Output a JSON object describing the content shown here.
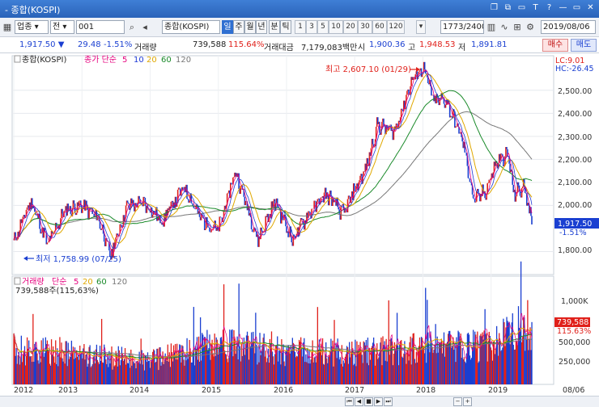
{
  "window": {
    "title": "종합(KOSPI)"
  },
  "window_controls": [
    "❐",
    "⧉",
    "▭",
    "T",
    "?",
    "—",
    "▭",
    "✕"
  ],
  "toolbar": {
    "market": "업종",
    "prefix": "전",
    "code": "001",
    "name": "종합(KOSPI)",
    "periods": [
      "일",
      "주",
      "월",
      "년",
      "분",
      "틱"
    ],
    "active_period": "일",
    "intervals": [
      "1",
      "3",
      "5",
      "10",
      "20",
      "30",
      "60",
      "120"
    ],
    "count": "1773/2400",
    "date": "2019/08/06"
  },
  "quote": {
    "price": "1,917.50",
    "arrow": "▼",
    "change": "29.48",
    "change_pct": "-1.51%",
    "volume_label": "거래량",
    "volume": "739,588",
    "volume_pct": "115.64%",
    "amount_label": "거래대금",
    "amount": "7,179,083백만",
    "open_label": "시",
    "open": "1,900.36",
    "high_label": "고",
    "high": "1,948.53",
    "low_label": "저",
    "low": "1,891.81",
    "buy": "매수",
    "sell": "매도"
  },
  "colors": {
    "up": "#e0201a",
    "down": "#1a3fd1",
    "ma5": "#e6007e",
    "ma10": "#1f3bd6",
    "ma20": "#e0a800",
    "ma60": "#1a8a2a",
    "ma120": "#777777"
  },
  "price_legend": {
    "name": "종합(KOSPI)",
    "type": "종가 단순",
    "periods": [
      "5",
      "10",
      "20",
      "60",
      "120"
    ]
  },
  "volume_legend": {
    "name": "거래량",
    "type": "단순",
    "periods": [
      "5",
      "20",
      "60",
      "120"
    ],
    "value": "739,588주(115,63%)"
  },
  "annotations": {
    "high": "최고 2,607.10 (01/29)",
    "low": "최저 1,758.99 (07/25)",
    "lc": "LC:9.01",
    "hc": "HC:-26.45",
    "current_price": "1,917.50",
    "current_pct": "-1.51%",
    "current_volume": "739,588",
    "current_volume_pct": "115.63%"
  },
  "chart_data": {
    "type": "line",
    "price_axis_ticks": [
      "2,500.00",
      "2,400.00",
      "2,300.00",
      "2,200.00",
      "2,100.00",
      "2,000.00",
      "1,800.00"
    ],
    "volume_axis_ticks": [
      "1,000K",
      "500,000",
      "250,000"
    ],
    "x_axis_ticks": [
      "2012",
      "2013",
      "2014",
      "2015",
      "2016",
      "2017",
      "2018",
      "2019",
      "08/06"
    ],
    "ylim": [
      1700,
      2650
    ],
    "series": [
      {
        "name": "종합(KOSPI)",
        "dates": [
          "2012-01",
          "2012-04",
          "2012-07",
          "2012-10",
          "2013-01",
          "2013-04",
          "2013-06",
          "2013-09",
          "2013-12",
          "2014-03",
          "2014-07",
          "2014-10",
          "2015-01",
          "2015-04",
          "2015-08",
          "2015-11",
          "2016-02",
          "2016-05",
          "2016-08",
          "2016-11",
          "2017-01",
          "2017-03",
          "2017-05",
          "2017-08",
          "2017-11",
          "2018-01",
          "2018-03",
          "2018-05",
          "2018-08",
          "2018-10",
          "2018-12",
          "2019-02",
          "2019-04",
          "2019-05",
          "2019-07",
          "2019-08-06"
        ],
        "values": [
          1840,
          2020,
          1830,
          1980,
          2000,
          1940,
          1780,
          2000,
          2010,
          1930,
          2080,
          1940,
          1890,
          2150,
          1850,
          2020,
          1850,
          1970,
          2050,
          1960,
          2070,
          2160,
          2350,
          2320,
          2540,
          2600,
          2450,
          2460,
          2280,
          2020,
          2060,
          2190,
          2220,
          2050,
          2080,
          1917.5
        ]
      },
      {
        "name": "거래량",
        "dates": [
          "2012",
          "2013",
          "2014",
          "2015",
          "2016",
          "2017",
          "2018",
          "2019",
          "2019-08-06"
        ],
        "values": [
          420000,
          350000,
          280000,
          480000,
          390000,
          380000,
          430000,
          460000,
          739588
        ]
      }
    ]
  }
}
